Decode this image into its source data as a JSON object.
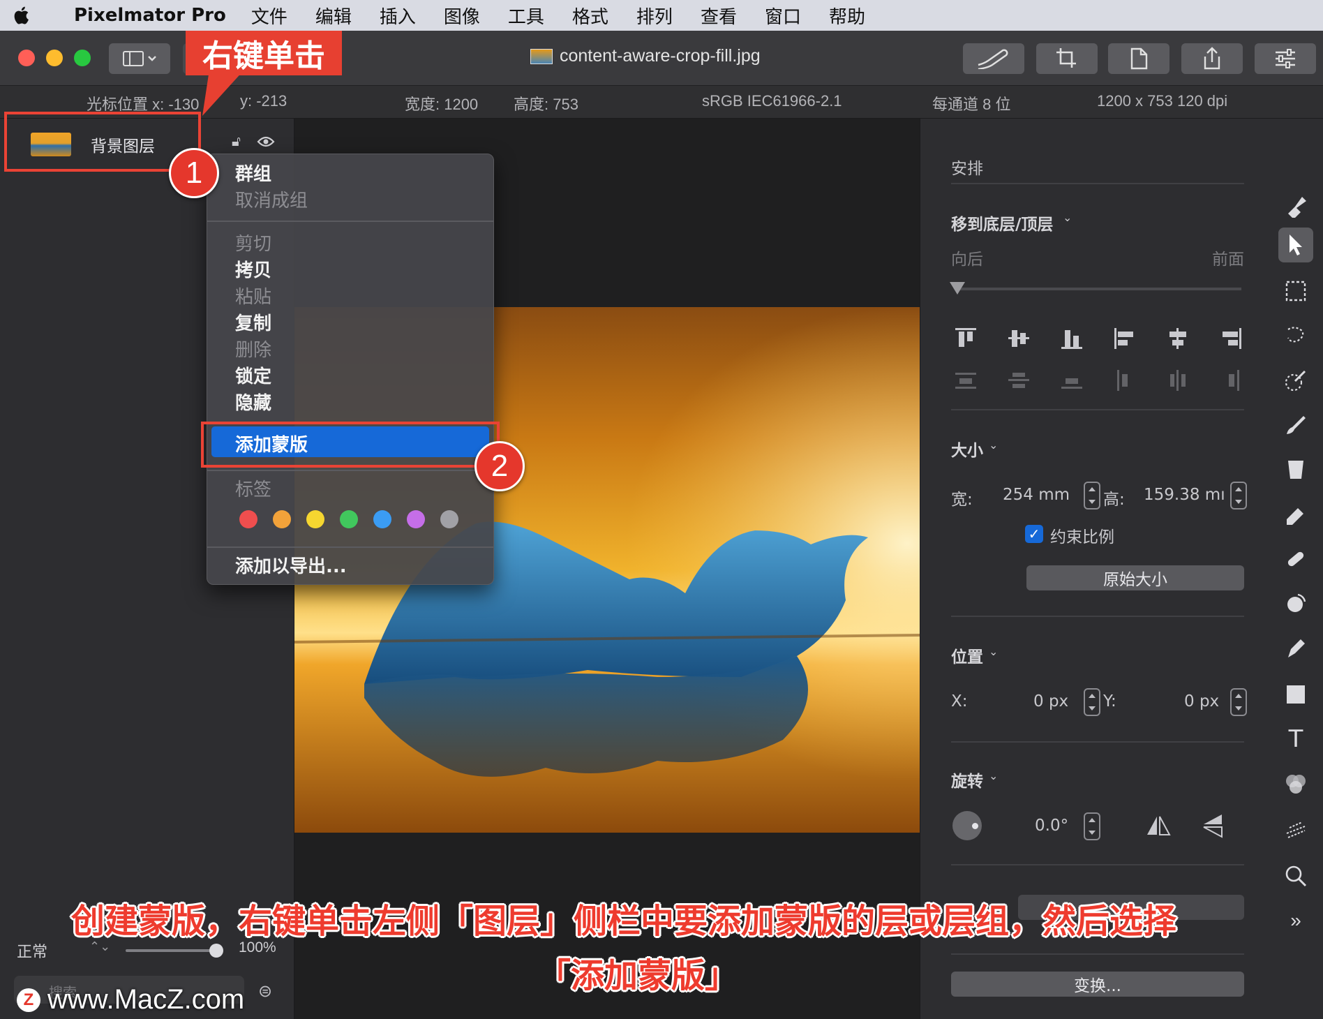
{
  "menubar": {
    "app_name": "Pixelmator Pro",
    "items": [
      "文件",
      "编辑",
      "插入",
      "图像",
      "工具",
      "格式",
      "排列",
      "查看",
      "窗口",
      "帮助"
    ]
  },
  "titlebar": {
    "document_title": "content-aware-crop-fill.jpg",
    "traffic_colors": [
      "#ff5f57",
      "#febc2e",
      "#28c840"
    ]
  },
  "infobar": {
    "cursor_x_label": "光标位置 x: -130",
    "cursor_y_label": "y: -213",
    "width_label": "宽度: 1200",
    "height_label": "高度: 753",
    "color_profile": "sRGB IEC61966-2.1",
    "bit_depth": "每通道 8 位",
    "resolution": "1200 x 753 120 dpi"
  },
  "layers": {
    "layer_name": "背景图层",
    "blend_mode": "正常",
    "opacity": "100%",
    "opacity_value": 1.0,
    "search_placeholder": "搜索"
  },
  "context_menu": {
    "group": "群组",
    "ungroup": "取消成组",
    "cut": "剪切",
    "copy": "拷贝",
    "paste": "粘贴",
    "duplicate": "复制",
    "delete": "删除",
    "lock": "锁定",
    "hide": "隐藏",
    "add_mask": "添加蒙版",
    "tags": "标签",
    "add_export": "添加以导出...",
    "tag_colors": [
      "#ef4e4e",
      "#f2a23a",
      "#f6d630",
      "#41c75d",
      "#3b9cf3",
      "#c56ee8",
      "#a1a1a6"
    ]
  },
  "arrange_panel": {
    "section_title": "安排",
    "move_label": "移到底层/顶层",
    "back_label": "向后",
    "front_label": "前面",
    "size_title": "大小",
    "width_label": "宽:",
    "width_value": "254 mm",
    "height_label": "高:",
    "height_value": "159.38 mı",
    "constrain_label": "约束比例",
    "constrain_checked": true,
    "original_size_button": "原始大小",
    "position_title": "位置",
    "x_label": "X:",
    "x_value": "0 px",
    "y_label": "Y:",
    "y_value": "0 px",
    "rotation_title": "旋转",
    "rotation_value": "0.0°",
    "transform_button": "变换..."
  },
  "annotations": {
    "step1": "1",
    "step2": "2",
    "callout": "右键单击",
    "caption_line1": "创建蒙版，右键单击左侧「图层」侧栏中要添加蒙版的层或层组，然后选择",
    "caption_line2": "「添加蒙版」",
    "watermark": "www.MacZ.com",
    "accent_color": "#e74031",
    "highlight_color": "#1669d8"
  }
}
